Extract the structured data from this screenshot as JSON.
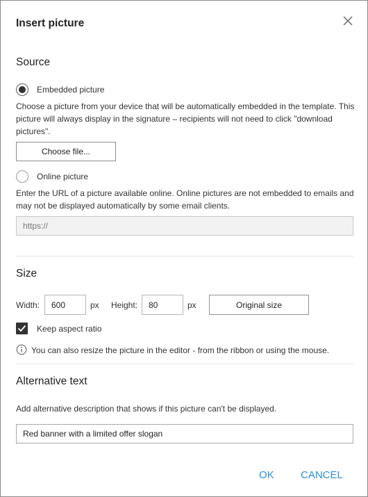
{
  "dialog": {
    "title": "Insert picture",
    "close_icon": "close-icon"
  },
  "source": {
    "heading": "Source",
    "embedded": {
      "label": "Embedded picture",
      "checked": true,
      "description": "Choose a picture from your device that will be automatically embedded in the template. This picture will always display in the signature – recipients will not need to click \"download pictures\".",
      "choose_file_label": "Choose file..."
    },
    "online": {
      "label": "Online picture",
      "checked": false,
      "description": "Enter the URL of a picture available online. Online pictures are not embedded to emails and may not be displayed automatically by some email clients.",
      "url_placeholder": "https://"
    }
  },
  "size": {
    "heading": "Size",
    "width_label": "Width:",
    "width_value": "600",
    "width_unit": "px",
    "height_label": "Height:",
    "height_value": "80",
    "height_unit": "px",
    "original_size_label": "Original size",
    "keep_aspect_label": "Keep aspect ratio",
    "keep_aspect_checked": true,
    "info_text": "You can also resize the picture in the editor - from the ribbon or using the mouse."
  },
  "alt_text": {
    "heading": "Alternative text",
    "description": "Add alternative description that shows if this picture can't be displayed.",
    "value": "Red banner with a limited offer slogan"
  },
  "footer": {
    "ok_label": "OK",
    "cancel_label": "CANCEL"
  },
  "colors": {
    "accent": "#2f8fd8",
    "border": "#8a8a8a",
    "disabled_input_bg": "#f2f2f2"
  }
}
